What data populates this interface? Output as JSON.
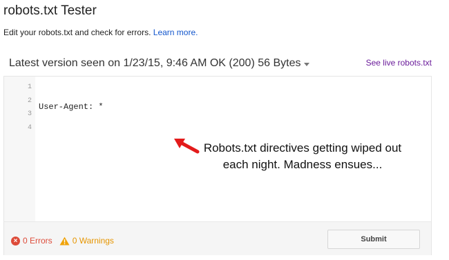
{
  "header": {
    "title": "robots.txt Tester",
    "subtitle": "Edit your robots.txt and check for errors.",
    "learn_more": "Learn more."
  },
  "version_bar": {
    "label": "Latest version seen on 1/23/15, 9:46 AM OK (200) 56 Bytes",
    "live_link": "See live robots.txt"
  },
  "editor": {
    "line_numbers": [
      "1",
      "2",
      "3",
      "4"
    ],
    "lines": [
      "User-Agent: *",
      "",
      "",
      ""
    ]
  },
  "footer": {
    "errors": "0 Errors",
    "warnings": "0 Warnings",
    "submit_label": "Submit"
  },
  "annotation": {
    "line1": "Robots.txt directives getting wiped out",
    "line2": "each night. Madness ensues..."
  },
  "colors": {
    "error": "#dd4b39",
    "warning": "#e69500",
    "link": "#1155cc",
    "visited_link": "#6a1b9a",
    "arrow": "#e31b1b"
  }
}
